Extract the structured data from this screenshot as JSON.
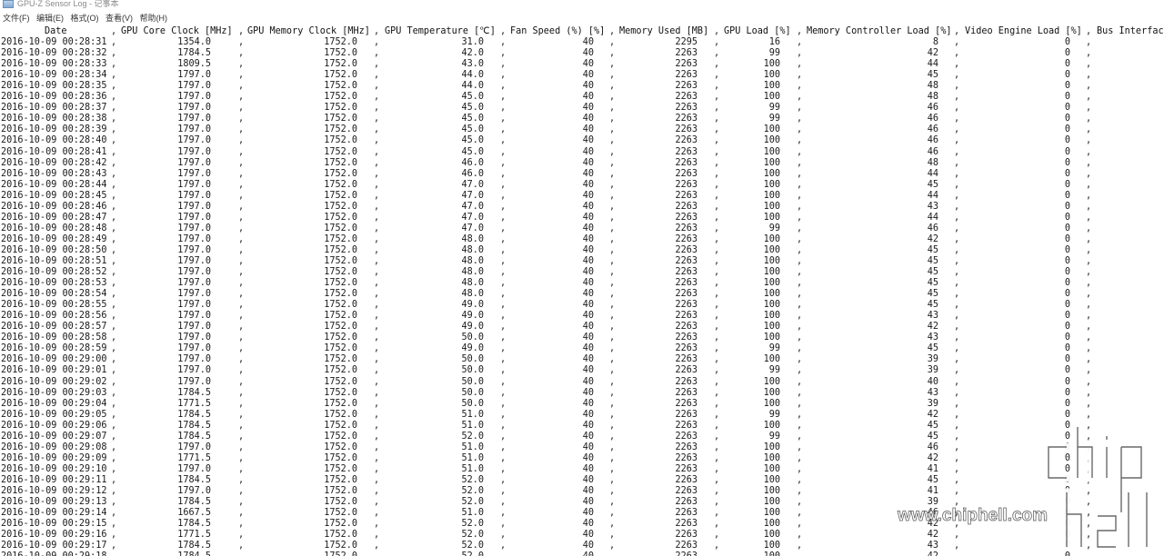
{
  "window": {
    "title": "GPU-Z Sensor Log - 记事本",
    "icon": "notepad-icon"
  },
  "menu": [
    {
      "label": "文件(F)"
    },
    {
      "label": "编辑(E)"
    },
    {
      "label": "格式(O)"
    },
    {
      "label": "查看(V)"
    },
    {
      "label": "帮助(H)"
    }
  ],
  "table": {
    "headers": {
      "date": "Date",
      "core": "GPU Core Clock [MHz]",
      "mem": "GPU Memory Clock [MHz]",
      "temp": "GPU Temperature [℃]",
      "fan": "Fan Speed (%) [%]",
      "used": "Memory Used [MB]",
      "load": "GPU Load [%]",
      "mcl": "Memory Controller Load [%]",
      "vel": "Video Engine Load [%]",
      "bus": "Bus Interfac"
    },
    "separator": ",",
    "rows": [
      [
        "2016-10-09 00:28:31",
        "1354.0",
        "1752.0",
        "31.0",
        "40",
        "2295",
        "16",
        "8",
        "0"
      ],
      [
        "2016-10-09 00:28:32",
        "1784.5",
        "1752.0",
        "42.0",
        "40",
        "2263",
        "99",
        "42",
        "0"
      ],
      [
        "2016-10-09 00:28:33",
        "1809.5",
        "1752.0",
        "43.0",
        "40",
        "2263",
        "100",
        "44",
        "0"
      ],
      [
        "2016-10-09 00:28:34",
        "1797.0",
        "1752.0",
        "44.0",
        "40",
        "2263",
        "100",
        "45",
        "0"
      ],
      [
        "2016-10-09 00:28:35",
        "1797.0",
        "1752.0",
        "44.0",
        "40",
        "2263",
        "100",
        "48",
        "0"
      ],
      [
        "2016-10-09 00:28:36",
        "1797.0",
        "1752.0",
        "45.0",
        "40",
        "2263",
        "100",
        "48",
        "0"
      ],
      [
        "2016-10-09 00:28:37",
        "1797.0",
        "1752.0",
        "45.0",
        "40",
        "2263",
        "99",
        "46",
        "0"
      ],
      [
        "2016-10-09 00:28:38",
        "1797.0",
        "1752.0",
        "45.0",
        "40",
        "2263",
        "99",
        "46",
        "0"
      ],
      [
        "2016-10-09 00:28:39",
        "1797.0",
        "1752.0",
        "45.0",
        "40",
        "2263",
        "100",
        "46",
        "0"
      ],
      [
        "2016-10-09 00:28:40",
        "1797.0",
        "1752.0",
        "45.0",
        "40",
        "2263",
        "100",
        "46",
        "0"
      ],
      [
        "2016-10-09 00:28:41",
        "1797.0",
        "1752.0",
        "45.0",
        "40",
        "2263",
        "100",
        "46",
        "0"
      ],
      [
        "2016-10-09 00:28:42",
        "1797.0",
        "1752.0",
        "46.0",
        "40",
        "2263",
        "100",
        "48",
        "0"
      ],
      [
        "2016-10-09 00:28:43",
        "1797.0",
        "1752.0",
        "46.0",
        "40",
        "2263",
        "100",
        "44",
        "0"
      ],
      [
        "2016-10-09 00:28:44",
        "1797.0",
        "1752.0",
        "47.0",
        "40",
        "2263",
        "100",
        "45",
        "0"
      ],
      [
        "2016-10-09 00:28:45",
        "1797.0",
        "1752.0",
        "47.0",
        "40",
        "2263",
        "100",
        "44",
        "0"
      ],
      [
        "2016-10-09 00:28:46",
        "1797.0",
        "1752.0",
        "47.0",
        "40",
        "2263",
        "100",
        "43",
        "0"
      ],
      [
        "2016-10-09 00:28:47",
        "1797.0",
        "1752.0",
        "47.0",
        "40",
        "2263",
        "100",
        "44",
        "0"
      ],
      [
        "2016-10-09 00:28:48",
        "1797.0",
        "1752.0",
        "47.0",
        "40",
        "2263",
        "99",
        "46",
        "0"
      ],
      [
        "2016-10-09 00:28:49",
        "1797.0",
        "1752.0",
        "48.0",
        "40",
        "2263",
        "100",
        "42",
        "0"
      ],
      [
        "2016-10-09 00:28:50",
        "1797.0",
        "1752.0",
        "48.0",
        "40",
        "2263",
        "100",
        "45",
        "0"
      ],
      [
        "2016-10-09 00:28:51",
        "1797.0",
        "1752.0",
        "48.0",
        "40",
        "2263",
        "100",
        "45",
        "0"
      ],
      [
        "2016-10-09 00:28:52",
        "1797.0",
        "1752.0",
        "48.0",
        "40",
        "2263",
        "100",
        "45",
        "0"
      ],
      [
        "2016-10-09 00:28:53",
        "1797.0",
        "1752.0",
        "48.0",
        "40",
        "2263",
        "100",
        "45",
        "0"
      ],
      [
        "2016-10-09 00:28:54",
        "1797.0",
        "1752.0",
        "48.0",
        "40",
        "2263",
        "100",
        "45",
        "0"
      ],
      [
        "2016-10-09 00:28:55",
        "1797.0",
        "1752.0",
        "49.0",
        "40",
        "2263",
        "100",
        "45",
        "0"
      ],
      [
        "2016-10-09 00:28:56",
        "1797.0",
        "1752.0",
        "49.0",
        "40",
        "2263",
        "100",
        "43",
        "0"
      ],
      [
        "2016-10-09 00:28:57",
        "1797.0",
        "1752.0",
        "49.0",
        "40",
        "2263",
        "100",
        "42",
        "0"
      ],
      [
        "2016-10-09 00:28:58",
        "1797.0",
        "1752.0",
        "50.0",
        "40",
        "2263",
        "100",
        "43",
        "0"
      ],
      [
        "2016-10-09 00:28:59",
        "1797.0",
        "1752.0",
        "49.0",
        "40",
        "2263",
        "99",
        "45",
        "0"
      ],
      [
        "2016-10-09 00:29:00",
        "1797.0",
        "1752.0",
        "50.0",
        "40",
        "2263",
        "100",
        "39",
        "0"
      ],
      [
        "2016-10-09 00:29:01",
        "1797.0",
        "1752.0",
        "50.0",
        "40",
        "2263",
        "99",
        "39",
        "0"
      ],
      [
        "2016-10-09 00:29:02",
        "1797.0",
        "1752.0",
        "50.0",
        "40",
        "2263",
        "100",
        "40",
        "0"
      ],
      [
        "2016-10-09 00:29:03",
        "1784.5",
        "1752.0",
        "50.0",
        "40",
        "2263",
        "100",
        "43",
        "0"
      ],
      [
        "2016-10-09 00:29:04",
        "1771.5",
        "1752.0",
        "50.0",
        "40",
        "2263",
        "100",
        "39",
        "0"
      ],
      [
        "2016-10-09 00:29:05",
        "1784.5",
        "1752.0",
        "51.0",
        "40",
        "2263",
        "99",
        "42",
        "0"
      ],
      [
        "2016-10-09 00:29:06",
        "1784.5",
        "1752.0",
        "51.0",
        "40",
        "2263",
        "100",
        "45",
        "0"
      ],
      [
        "2016-10-09 00:29:07",
        "1784.5",
        "1752.0",
        "52.0",
        "40",
        "2263",
        "99",
        "45",
        "0"
      ],
      [
        "2016-10-09 00:29:08",
        "1797.0",
        "1752.0",
        "51.0",
        "40",
        "2263",
        "100",
        "46",
        "0"
      ],
      [
        "2016-10-09 00:29:09",
        "1771.5",
        "1752.0",
        "51.0",
        "40",
        "2263",
        "100",
        "42",
        "0"
      ],
      [
        "2016-10-09 00:29:10",
        "1797.0",
        "1752.0",
        "51.0",
        "40",
        "2263",
        "100",
        "41",
        "0"
      ],
      [
        "2016-10-09 00:29:11",
        "1784.5",
        "1752.0",
        "52.0",
        "40",
        "2263",
        "100",
        "45",
        "0"
      ],
      [
        "2016-10-09 00:29:12",
        "1797.0",
        "1752.0",
        "52.0",
        "40",
        "2263",
        "100",
        "41",
        "0"
      ],
      [
        "2016-10-09 00:29:13",
        "1784.5",
        "1752.0",
        "52.0",
        "40",
        "2263",
        "100",
        "39",
        "0"
      ],
      [
        "2016-10-09 00:29:14",
        "1667.5",
        "1752.0",
        "51.0",
        "40",
        "2263",
        "100",
        "46",
        "0"
      ],
      [
        "2016-10-09 00:29:15",
        "1784.5",
        "1752.0",
        "52.0",
        "40",
        "2263",
        "100",
        "42",
        "0"
      ],
      [
        "2016-10-09 00:29:16",
        "1771.5",
        "1752.0",
        "52.0",
        "40",
        "2263",
        "100",
        "42",
        "0"
      ],
      [
        "2016-10-09 00:29:17",
        "1784.5",
        "1752.0",
        "52.0",
        "40",
        "2263",
        "100",
        "43",
        "0"
      ],
      [
        "2016-10-09 00:29:18",
        "1784.5",
        "1752.0",
        "52.0",
        "40",
        "2263",
        "100",
        "42",
        "0"
      ]
    ]
  },
  "watermark": {
    "logo": "chiphell",
    "url": "www.chiphell.com"
  }
}
